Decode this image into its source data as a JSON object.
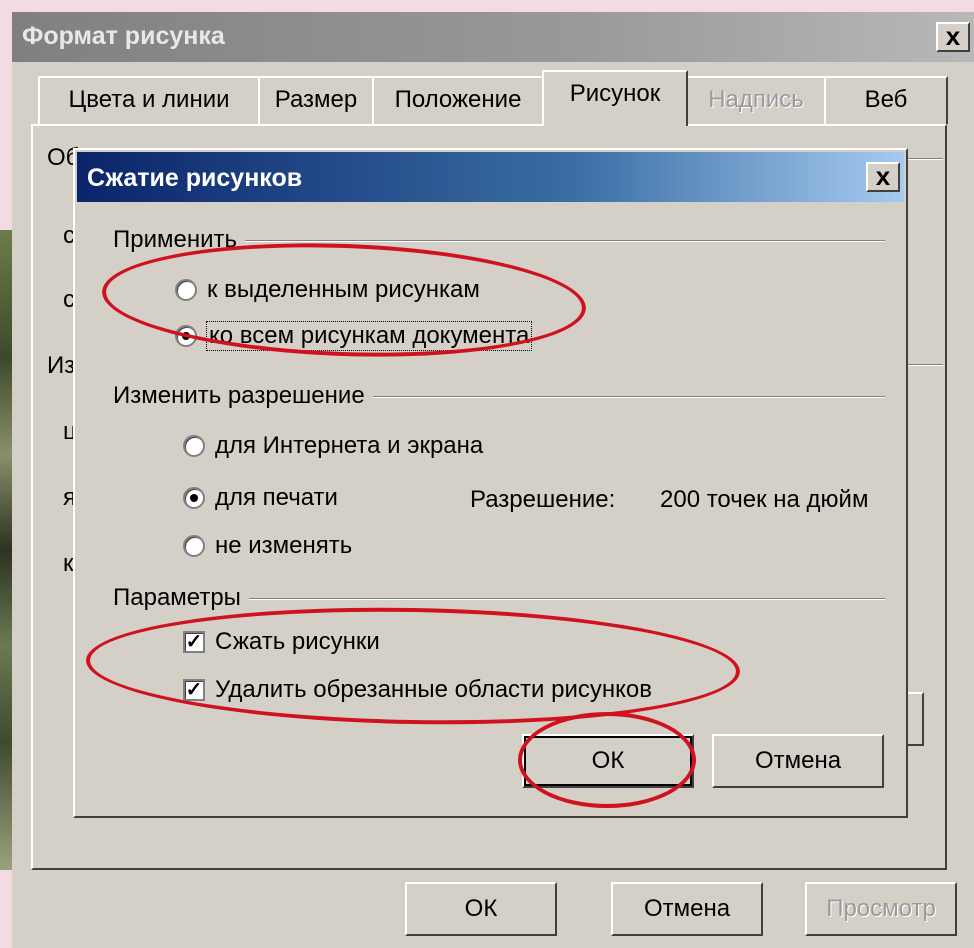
{
  "outer_dialog": {
    "title": "Формат рисунка",
    "close_label": "x",
    "tabs": [
      {
        "label": "Цвета и линии",
        "active": false,
        "disabled": false
      },
      {
        "label": "Размер",
        "active": false,
        "disabled": false
      },
      {
        "label": "Положение",
        "active": false,
        "disabled": false
      },
      {
        "label": "Рисунок",
        "active": true,
        "disabled": false
      },
      {
        "label": "Надпись",
        "active": false,
        "disabled": true
      },
      {
        "label": "Веб",
        "active": false,
        "disabled": false
      }
    ],
    "background_fragments": [
      "Обр",
      "сл",
      "ср",
      "Изс",
      "цв",
      "яр",
      "ко"
    ],
    "buttons": {
      "ok": "ОК",
      "cancel": "Отмена",
      "preview": "Просмотр"
    }
  },
  "compress_dialog": {
    "title": "Сжатие рисунков",
    "close_label": "x",
    "apply": {
      "label": "Применить",
      "options": [
        {
          "label": "к выделенным рисункам",
          "checked": false
        },
        {
          "label": "ко всем рисункам документа",
          "checked": true
        }
      ]
    },
    "resolution": {
      "label": "Изменить разрешение",
      "options": [
        {
          "label": "для Интернета и экрана",
          "checked": false
        },
        {
          "label": "для печати",
          "checked": true
        },
        {
          "label": "не изменять",
          "checked": false
        }
      ],
      "readout_label": "Разрешение:",
      "readout_value": "200 точек на дюйм"
    },
    "params": {
      "label": "Параметры",
      "options": [
        {
          "label": "Сжать рисунки",
          "checked": true
        },
        {
          "label": "Удалить обрезанные области рисунков",
          "checked": true
        }
      ]
    },
    "buttons": {
      "ok": "ОК",
      "cancel": "Отмена"
    }
  },
  "colors": {
    "highlight_ellipse": "#d0121f",
    "active_title": "#0a246a",
    "inactive_title": "#808080"
  }
}
